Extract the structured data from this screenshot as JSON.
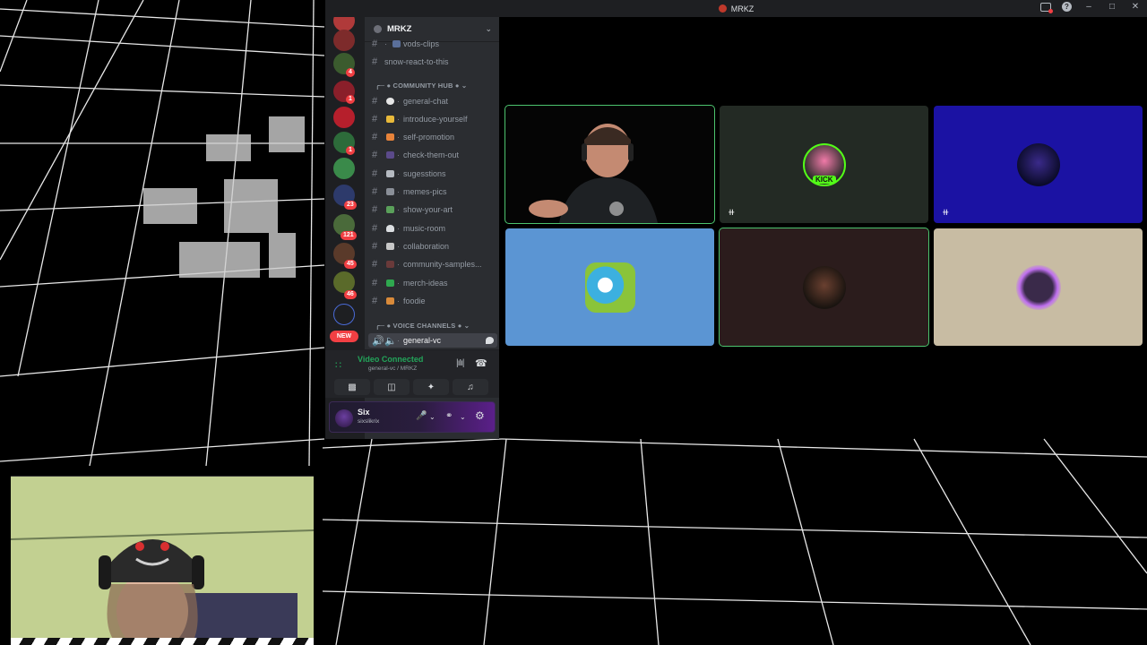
{
  "window": {
    "title": "MRKZ",
    "title_color": "#c0392b"
  },
  "server": {
    "name": "MRKZ"
  },
  "server_rail": {
    "badges": [
      "4",
      "1",
      "1",
      "23",
      "121",
      "45",
      "46"
    ],
    "new_label": "NEW"
  },
  "channels": {
    "top": [
      {
        "label": "vods-clips",
        "icon": "video-icon"
      },
      {
        "label": "snow-react-to-this",
        "icon": ""
      }
    ],
    "community_hub_label": "COMMUNITY HUB",
    "community_hub": [
      {
        "label": "general-chat",
        "icon": "speech-icon"
      },
      {
        "label": "introduce-yourself",
        "icon": "id-card-icon"
      },
      {
        "label": "self-promotion",
        "icon": "megaphone-icon"
      },
      {
        "label": "check-them-out",
        "icon": "eyes-icon"
      },
      {
        "label": "sugesstions",
        "icon": "box-icon"
      },
      {
        "label": "memes-pics",
        "icon": "camera-icon"
      },
      {
        "label": "show-your-art",
        "icon": "picture-icon"
      },
      {
        "label": "music-room",
        "icon": "headphones-icon"
      },
      {
        "label": "collaboration",
        "icon": "handshake-icon"
      },
      {
        "label": "community-samples...",
        "icon": "sparkle-icon"
      },
      {
        "label": "merch-ideas",
        "icon": "shirt-icon"
      },
      {
        "label": "foodie",
        "icon": "food-icon"
      }
    ],
    "voice_channels_label": "VOICE CHANNELS",
    "voice_active": {
      "label": "general-vc"
    }
  },
  "voice": {
    "status": "Video Connected",
    "location": "general-vc / MRKZ"
  },
  "user": {
    "name": "Six",
    "handle": "sixslikrix"
  },
  "video_tiles": [
    {
      "name": "tile-1",
      "bg": "#000000",
      "speaking": true,
      "muted": false
    },
    {
      "name": "tile-2",
      "bg": "#232a24",
      "speaking": false,
      "muted": true
    },
    {
      "name": "tile-3",
      "bg": "#1b12a3",
      "speaking": false,
      "muted": true
    },
    {
      "name": "tile-4",
      "bg": "#5b95d3",
      "speaking": false,
      "muted": false
    },
    {
      "name": "tile-5",
      "bg": "#2b1c1c",
      "speaking": true,
      "muted": false
    },
    {
      "name": "tile-6",
      "bg": "#c8bca3",
      "speaking": false,
      "muted": false
    }
  ],
  "tile_labels": {
    "kick": "KICK"
  }
}
